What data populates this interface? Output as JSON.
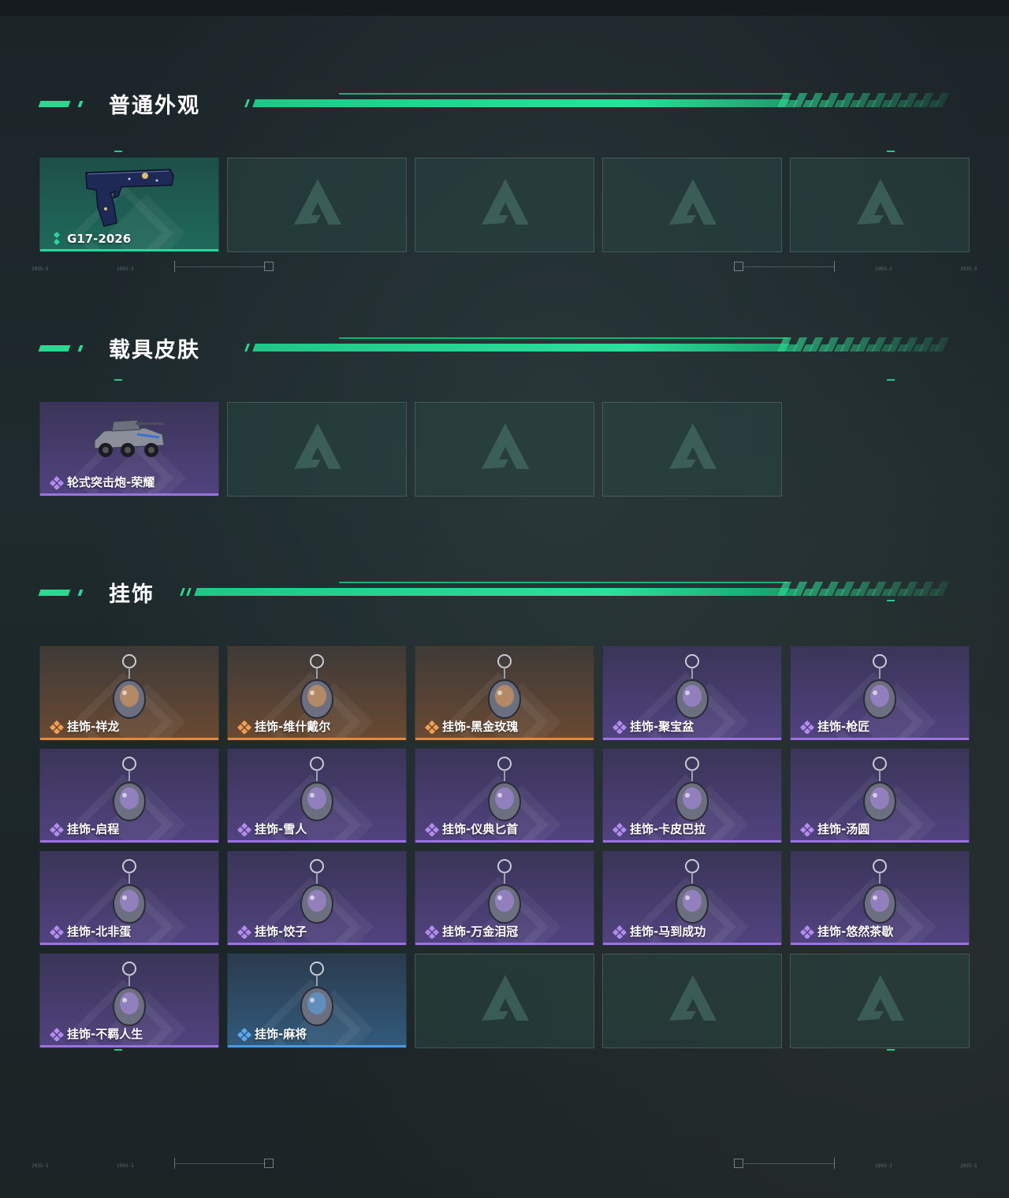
{
  "sections": [
    {
      "title": "普通外观",
      "items": [
        {
          "label": "G17-2026",
          "rarity": "green",
          "icon": "pistol-icon"
        }
      ],
      "empty_count": 4
    },
    {
      "title": "载具皮肤",
      "items": [
        {
          "label": "轮式突击炮-荣耀",
          "rarity": "purple",
          "icon": "armored-vehicle-icon"
        }
      ],
      "empty_count": 3
    },
    {
      "title": "挂饰",
      "items": [
        {
          "label": "挂饰-祥龙",
          "rarity": "orange",
          "icon": "dragon-charm-icon"
        },
        {
          "label": "挂饰-维什戴尔",
          "rarity": "orange",
          "icon": "card-charm-icon"
        },
        {
          "label": "挂饰-黑金玫瑰",
          "rarity": "orange",
          "icon": "rose-charm-icon"
        },
        {
          "label": "挂饰-聚宝盆",
          "rarity": "purple",
          "icon": "treasure-bowl-charm-icon"
        },
        {
          "label": "挂饰-枪匠",
          "rarity": "purple",
          "icon": "gunsmith-charm-icon"
        },
        {
          "label": "挂饰-启程",
          "rarity": "purple",
          "icon": "medal-charm-icon"
        },
        {
          "label": "挂饰-雪人",
          "rarity": "purple",
          "icon": "snowman-charm-icon"
        },
        {
          "label": "挂饰-仪典匕首",
          "rarity": "purple",
          "icon": "dagger-charm-icon"
        },
        {
          "label": "挂饰-卡皮巴拉",
          "rarity": "purple",
          "icon": "capybara-charm-icon"
        },
        {
          "label": "挂饰-汤圆",
          "rarity": "purple",
          "icon": "dumpling-bowl-charm-icon"
        },
        {
          "label": "挂饰-北非蛋",
          "rarity": "purple",
          "icon": "shakshuka-charm-icon"
        },
        {
          "label": "挂饰-饺子",
          "rarity": "purple",
          "icon": "dumplings-charm-icon"
        },
        {
          "label": "挂饰-万金泪冠",
          "rarity": "purple",
          "icon": "crown-charm-icon"
        },
        {
          "label": "挂饰-马到成功",
          "rarity": "purple",
          "icon": "horse-charm-icon"
        },
        {
          "label": "挂饰-悠然茶歇",
          "rarity": "purple",
          "icon": "cupcake-charm-icon"
        },
        {
          "label": "挂饰-不羁人生",
          "rarity": "purple",
          "icon": "sneaker-charm-icon"
        },
        {
          "label": "挂饰-麻将",
          "rarity": "blue",
          "icon": "mahjong-charm-icon"
        }
      ],
      "empty_count": 3
    }
  ],
  "colors": {
    "accent": "#2bd88f",
    "rarity_green": "#2cd39a",
    "rarity_purple": "#9b72e0",
    "rarity_orange": "#e08a3f",
    "rarity_blue": "#4a9be6"
  },
  "deco_text": [
    "2035-5",
    "1993-3",
    "1993-3",
    "2035-5"
  ]
}
